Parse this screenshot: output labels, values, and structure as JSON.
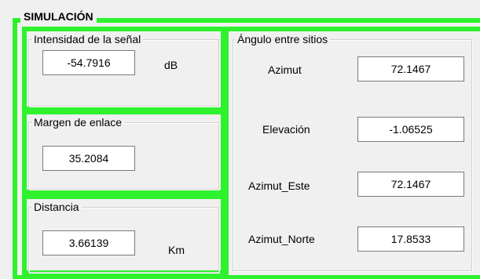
{
  "simulation": {
    "title": "SIMULACIÓN",
    "signal": {
      "legend": "Intensidad de la señal",
      "value": "-54.7916",
      "unit": "dB"
    },
    "margin": {
      "legend": "Margen de enlace",
      "value": "35.2084"
    },
    "distance": {
      "legend": "Distancia",
      "value": "3.66139",
      "unit": "Km"
    },
    "angles": {
      "legend": "Ángulo entre sitios",
      "azimut": {
        "label": "Azimut",
        "value": "72.1467"
      },
      "elevacion": {
        "label": "Elevación",
        "value": "-1.06525"
      },
      "azimut_este": {
        "label": "Azimut_Este",
        "value": "72.1467"
      },
      "azimut_norte": {
        "label": "Azimut_Norte",
        "value": "17.8533"
      }
    }
  },
  "colors": {
    "panel_border": "#2ef22e",
    "background": "#f0f0f0"
  }
}
